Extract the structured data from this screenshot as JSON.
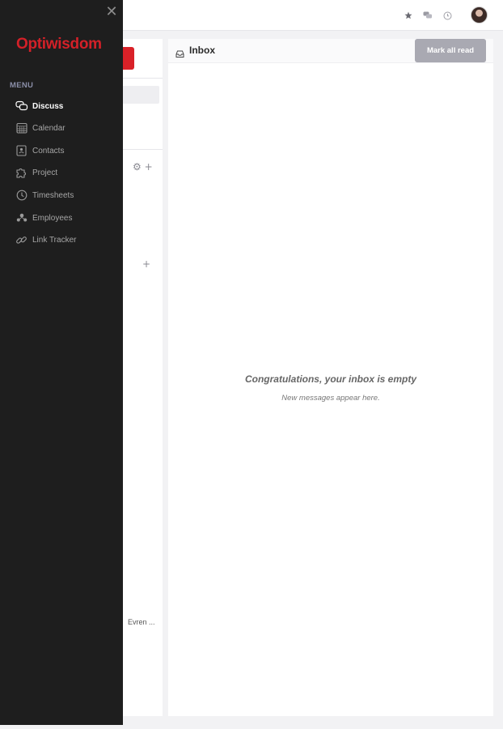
{
  "header": {
    "icons": [
      "star-icon",
      "chat-icon",
      "clock-icon"
    ],
    "avatar": "user-avatar"
  },
  "drawer": {
    "brand": "Optiwisdom",
    "menu_heading": "MENU",
    "items": [
      {
        "label": "Discuss",
        "icon": "chat-icon",
        "active": true
      },
      {
        "label": "Calendar",
        "icon": "calendar-icon",
        "active": false
      },
      {
        "label": "Contacts",
        "icon": "contact-card-icon",
        "active": false
      },
      {
        "label": "Project",
        "icon": "puzzle-icon",
        "active": false
      },
      {
        "label": "Timesheets",
        "icon": "clock-icon",
        "active": false
      },
      {
        "label": "Employees",
        "icon": "people-icon",
        "active": false
      },
      {
        "label": "Link Tracker",
        "icon": "link-icon",
        "active": false
      }
    ]
  },
  "left_panel": {
    "channel_actions": "⚙ +",
    "dm_action": "+",
    "truncated_item": "Evren ..."
  },
  "inbox": {
    "title": "Inbox",
    "mark_all_read": "Mark all read",
    "empty_title": "Congratulations, your inbox is empty",
    "empty_subtitle": "New messages appear here."
  },
  "colors": {
    "brand_red": "#d32028",
    "drawer_bg": "#1e1e1e",
    "button_gray": "#a9a9b2"
  }
}
